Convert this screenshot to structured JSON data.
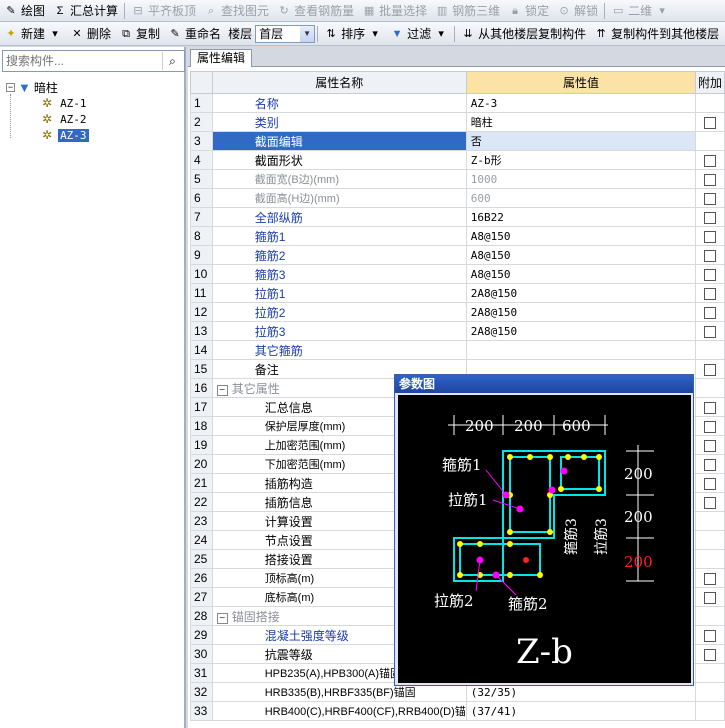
{
  "toolbar1": {
    "items": [
      {
        "label": "绘图",
        "enabled": true
      },
      {
        "label": "汇总计算",
        "enabled": true
      },
      {
        "label": "平齐板顶",
        "enabled": false
      },
      {
        "label": "查找图元",
        "enabled": false
      },
      {
        "label": "查看钢筋量",
        "enabled": false
      },
      {
        "label": "批量选择",
        "enabled": false
      },
      {
        "label": "钢筋三维",
        "enabled": false
      },
      {
        "label": "锁定",
        "enabled": false
      },
      {
        "label": "解锁",
        "enabled": false
      },
      {
        "label": "二维",
        "enabled": false
      }
    ]
  },
  "toolbar2": {
    "new_label": "新建",
    "delete_label": "删除",
    "copy_label": "复制",
    "rename_label": "重命名",
    "floor_label": "楼层",
    "floor_value": "首层",
    "sort_label": "排序",
    "filter_label": "过滤",
    "copy_from_label": "从其他楼层复制构件",
    "copy_to_label": "复制构件到其他楼层"
  },
  "search": {
    "placeholder": "搜索构件..."
  },
  "tree": {
    "root_label": "暗柱",
    "children": [
      "AZ-1",
      "AZ-2",
      "AZ-3"
    ],
    "selected": "AZ-3"
  },
  "tab": {
    "label": "属性编辑"
  },
  "grid": {
    "headers": {
      "name": "属性名称",
      "value": "属性值",
      "extra": "附加"
    },
    "rows": [
      {
        "n": "1",
        "name": "名称",
        "value": "AZ-3",
        "style": "blue",
        "indent": 0,
        "check": false
      },
      {
        "n": "2",
        "name": "类别",
        "value": "暗柱",
        "style": "blue",
        "indent": 0,
        "check": true
      },
      {
        "n": "3",
        "name": "截面编辑",
        "value": "否",
        "style": "blue",
        "indent": 0,
        "check": false,
        "selected": true
      },
      {
        "n": "4",
        "name": "截面形状",
        "value": "Z-b形",
        "style": "normal",
        "indent": 0,
        "check": true
      },
      {
        "n": "5",
        "name": "截面宽(B边)(mm)",
        "value": "1000",
        "style": "gray",
        "indent": 0,
        "check": true
      },
      {
        "n": "6",
        "name": "截面高(H边)(mm)",
        "value": "600",
        "style": "gray",
        "indent": 0,
        "check": true
      },
      {
        "n": "7",
        "name": "全部纵筋",
        "value": "16B22",
        "style": "blue",
        "indent": 0,
        "check": true
      },
      {
        "n": "8",
        "name": "箍筋1",
        "value": "A8@150",
        "style": "blue",
        "indent": 0,
        "check": true
      },
      {
        "n": "9",
        "name": "箍筋2",
        "value": "A8@150",
        "style": "blue",
        "indent": 0,
        "check": true
      },
      {
        "n": "10",
        "name": "箍筋3",
        "value": "A8@150",
        "style": "blue",
        "indent": 0,
        "check": true
      },
      {
        "n": "11",
        "name": "拉筋1",
        "value": "2A8@150",
        "style": "blue",
        "indent": 0,
        "check": true
      },
      {
        "n": "12",
        "name": "拉筋2",
        "value": "2A8@150",
        "style": "blue",
        "indent": 0,
        "check": true
      },
      {
        "n": "13",
        "name": "拉筋3",
        "value": "2A8@150",
        "style": "blue",
        "indent": 0,
        "check": true
      },
      {
        "n": "14",
        "name": "其它箍筋",
        "value": "",
        "style": "blue",
        "indent": 0,
        "check": false
      },
      {
        "n": "15",
        "name": "备注",
        "value": "",
        "style": "normal",
        "indent": 0,
        "check": true
      },
      {
        "n": "16",
        "name": "其它属性",
        "value": "",
        "style": "gray",
        "indent": 0,
        "check": false,
        "group": true
      },
      {
        "n": "17",
        "name": "汇总信息",
        "value": "",
        "style": "normal",
        "indent": 1,
        "check": true
      },
      {
        "n": "18",
        "name": "保护层厚度(mm)",
        "value": "",
        "style": "normal",
        "indent": 1,
        "check": true
      },
      {
        "n": "19",
        "name": "上加密范围(mm)",
        "value": "",
        "style": "normal",
        "indent": 1,
        "check": true
      },
      {
        "n": "20",
        "name": "下加密范围(mm)",
        "value": "",
        "style": "normal",
        "indent": 1,
        "check": true
      },
      {
        "n": "21",
        "name": "插筋构造",
        "value": "",
        "style": "normal",
        "indent": 1,
        "check": true
      },
      {
        "n": "22",
        "name": "插筋信息",
        "value": "",
        "style": "normal",
        "indent": 1,
        "check": true
      },
      {
        "n": "23",
        "name": "计算设置",
        "value": "",
        "style": "normal",
        "indent": 1,
        "check": false
      },
      {
        "n": "24",
        "name": "节点设置",
        "value": "",
        "style": "normal",
        "indent": 1,
        "check": false
      },
      {
        "n": "25",
        "name": "搭接设置",
        "value": "",
        "style": "normal",
        "indent": 1,
        "check": false
      },
      {
        "n": "26",
        "name": "顶标高(m)",
        "value": "",
        "style": "normal",
        "indent": 1,
        "check": true
      },
      {
        "n": "27",
        "name": "底标高(m)",
        "value": "",
        "style": "normal",
        "indent": 1,
        "check": true
      },
      {
        "n": "28",
        "name": "锚固搭接",
        "value": "",
        "style": "gray",
        "indent": 0,
        "check": false,
        "group": true
      },
      {
        "n": "29",
        "name": "混凝土强度等级",
        "value": "",
        "style": "blue",
        "indent": 1,
        "check": true
      },
      {
        "n": "30",
        "name": "抗震等级",
        "value": "",
        "style": "normal",
        "indent": 1,
        "check": true
      },
      {
        "n": "31",
        "name": "HPB235(A),HPB300(A)锚固",
        "value": "",
        "style": "normal",
        "indent": 1,
        "check": false
      },
      {
        "n": "32",
        "name": "HRB335(B),HRBF335(BF)锚固",
        "value": "(32/35)",
        "style": "normal",
        "indent": 1,
        "check": false
      },
      {
        "n": "33",
        "name": "HRB400(C),HRBF400(CF),RRB400(D)锚",
        "value": "(37/41)",
        "style": "normal",
        "indent": 1,
        "check": false
      }
    ]
  },
  "dialog": {
    "title": "参数图",
    "dims_top": [
      "200",
      "200",
      "600"
    ],
    "dims_right": [
      "200",
      "200",
      "200"
    ],
    "labels": {
      "gujin1": "箍筋1",
      "lajin1": "拉筋1",
      "lajin2": "拉筋2",
      "gujin2": "箍筋2",
      "gujin3": "箍筋3",
      "lajin3": "拉筋3"
    },
    "shape_name": "Z-b",
    "colors": {
      "background": "#000000",
      "outline": "#00e5e5",
      "bar": "#ffff00",
      "tie": "#ff00ff",
      "dim": "#ffffff",
      "highlight": "#ff2020"
    }
  }
}
